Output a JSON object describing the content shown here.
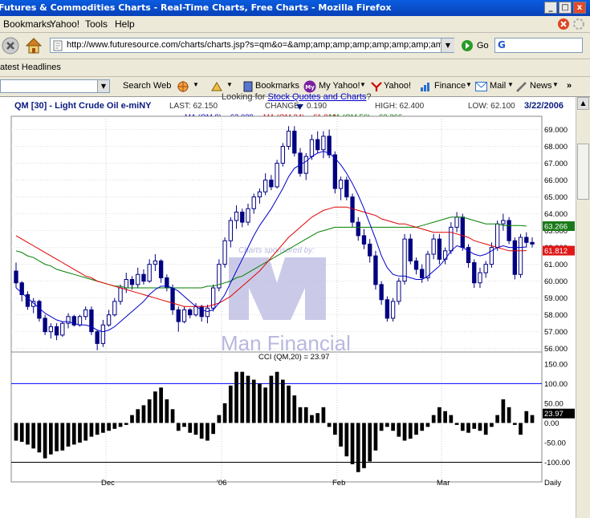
{
  "window": {
    "title": "Futures & Commodities Charts - Real-Time Charts, Free Charts - Mozilla Firefox",
    "min": "_",
    "max": "□",
    "close": "x"
  },
  "menu": [
    "Bookmarks",
    "Yahoo!",
    "Tools",
    "Help"
  ],
  "nav": {
    "url": "http://www.futuresource.com/charts/charts.jsp?s=qm&o=&amp;amp;amp;amp;amp;amp;amp;amp;amp;a=D",
    "go": "Go",
    "search_letter": "G"
  },
  "bookmarks_bar": {
    "item": "atest Headlines"
  },
  "yahoo_toolbar": {
    "search_web": "Search Web",
    "bookmarks": "Bookmarks",
    "my_yahoo": "My Yahoo!",
    "yahoo": "Yahoo!",
    "finance": "Finance",
    "mail": "Mail",
    "news": "News",
    "more": "»",
    "my": "My"
  },
  "page": {
    "link_prefix": "Looking for ",
    "link_text": "Stock Quotes and Charts",
    "link_suffix": "?"
  },
  "chart": {
    "symbol": "QM [30] - Light Crude Oil e-miNY",
    "last": "LAST: 62.150",
    "change_label": "CHANGE:",
    "change_value": "0.190",
    "high": "HIGH: 62.400",
    "low": "LOW: 62.100",
    "date": "3/22/2006",
    "ma9": "MA (QM,9) = 62.029",
    "ma34": "MA (QM,34) = 61.812",
    "ma50": "MA (QM,50) = 63.266",
    "price_ticks": [
      "69.000",
      "68.000",
      "67.000",
      "66.000",
      "65.000",
      "64.000",
      "63.000",
      "62.000",
      "61.000",
      "60.000",
      "59.000",
      "58.000",
      "57.000",
      "56.000"
    ],
    "tag_ma50": "63.266",
    "tag_ma34": "61.812",
    "watermark_sponsor": "Charts sponsored by:",
    "watermark_brand": "Man Financial",
    "cci_label": "CCI (QM,20) = 23.97",
    "cci_ticks": [
      "150.00",
      "100.00",
      "50.00",
      "0.00",
      "-50.00",
      "-100.00"
    ],
    "cci_tag": "23.97",
    "x_labels": [
      "Dec",
      "'06",
      "Feb",
      "Mar"
    ],
    "period": "Daily",
    "colors": {
      "ma9": "#0000cc",
      "ma34": "#e00000",
      "ma50": "#008000",
      "candle": "#000080",
      "candle_up": "#ffffff",
      "levels": "#0000ff",
      "watermark": "#b8b8e0"
    }
  },
  "chart_data": {
    "type": "candlestick",
    "title": "QM [30] - Light Crude Oil e-miNY",
    "price_range": [
      55.7,
      69.5
    ],
    "cci_range": [
      -150,
      160
    ],
    "series": [
      {
        "name": "MA (QM,9)",
        "last": 62.029
      },
      {
        "name": "MA (QM,34)",
        "last": 61.812
      },
      {
        "name": "MA (QM,50)",
        "last": 63.266
      },
      {
        "name": "CCI (QM,20)",
        "last": 23.97
      }
    ],
    "ohlc": [
      [
        60.6,
        61.1,
        59.6,
        59.9
      ],
      [
        59.9,
        60.0,
        58.8,
        59.2
      ],
      [
        59.2,
        59.4,
        58.3,
        58.5
      ],
      [
        58.5,
        59.0,
        58.1,
        58.8
      ],
      [
        58.8,
        58.9,
        57.6,
        57.8
      ],
      [
        57.8,
        58.0,
        56.8,
        57.0
      ],
      [
        57.0,
        57.5,
        56.6,
        57.3
      ],
      [
        57.3,
        57.5,
        56.5,
        56.8
      ],
      [
        56.8,
        57.6,
        56.7,
        57.5
      ],
      [
        57.5,
        58.1,
        57.2,
        57.9
      ],
      [
        57.9,
        58.0,
        57.3,
        57.4
      ],
      [
        57.4,
        58.0,
        57.3,
        57.9
      ],
      [
        57.9,
        58.5,
        57.7,
        58.3
      ],
      [
        58.3,
        58.5,
        56.8,
        57.0
      ],
      [
        57.0,
        57.1,
        55.9,
        56.3
      ],
      [
        56.3,
        57.7,
        56.1,
        57.4
      ],
      [
        57.4,
        58.3,
        57.3,
        58.0
      ],
      [
        58.0,
        59.0,
        57.9,
        58.8
      ],
      [
        58.8,
        59.8,
        58.6,
        59.6
      ],
      [
        59.6,
        60.5,
        59.3,
        60.1
      ],
      [
        60.1,
        60.3,
        59.5,
        59.8
      ],
      [
        59.8,
        60.8,
        59.6,
        60.4
      ],
      [
        60.4,
        60.7,
        59.8,
        60.0
      ],
      [
        60.0,
        61.3,
        59.9,
        61.0
      ],
      [
        61.0,
        61.6,
        60.6,
        61.2
      ],
      [
        61.2,
        61.3,
        59.9,
        60.2
      ],
      [
        60.2,
        60.4,
        59.4,
        59.6
      ],
      [
        59.6,
        59.8,
        58.0,
        58.3
      ],
      [
        58.3,
        58.5,
        57.0,
        57.6
      ],
      [
        57.6,
        58.5,
        57.5,
        58.3
      ],
      [
        58.3,
        58.4,
        57.8,
        58.0
      ],
      [
        58.0,
        58.7,
        57.9,
        58.5
      ],
      [
        58.5,
        58.6,
        57.6,
        57.9
      ],
      [
        57.9,
        58.6,
        57.5,
        58.4
      ],
      [
        58.4,
        59.8,
        58.2,
        59.6
      ],
      [
        59.6,
        61.3,
        59.4,
        61.0
      ],
      [
        61.0,
        62.6,
        60.8,
        62.4
      ],
      [
        62.4,
        63.8,
        62.0,
        63.6
      ],
      [
        63.6,
        64.5,
        63.1,
        64.1
      ],
      [
        64.1,
        64.3,
        63.2,
        63.5
      ],
      [
        63.5,
        64.6,
        63.3,
        64.3
      ],
      [
        64.3,
        65.2,
        64.0,
        65.0
      ],
      [
        65.0,
        65.5,
        64.6,
        65.3
      ],
      [
        65.3,
        66.4,
        65.1,
        66.0
      ],
      [
        66.0,
        66.3,
        65.4,
        65.6
      ],
      [
        65.6,
        67.2,
        65.5,
        67.0
      ],
      [
        67.0,
        68.2,
        66.8,
        68.0
      ],
      [
        68.0,
        69.2,
        67.8,
        68.9
      ],
      [
        68.9,
        69.2,
        67.4,
        67.6
      ],
      [
        67.6,
        67.9,
        66.2,
        66.4
      ],
      [
        66.4,
        67.6,
        66.0,
        67.4
      ],
      [
        67.4,
        68.7,
        67.2,
        68.4
      ],
      [
        68.4,
        68.9,
        67.6,
        67.8
      ],
      [
        67.8,
        68.9,
        67.3,
        68.6
      ],
      [
        68.6,
        69.0,
        67.3,
        67.5
      ],
      [
        67.5,
        67.7,
        65.2,
        65.5
      ],
      [
        65.5,
        66.2,
        64.8,
        66.0
      ],
      [
        66.0,
        66.2,
        64.8,
        65.0
      ],
      [
        65.0,
        65.2,
        63.2,
        63.5
      ],
      [
        63.5,
        63.8,
        62.4,
        62.7
      ],
      [
        62.7,
        63.1,
        61.9,
        62.2
      ],
      [
        62.2,
        62.5,
        61.1,
        61.5
      ],
      [
        61.5,
        61.8,
        59.5,
        59.8
      ],
      [
        59.8,
        60.0,
        58.6,
        58.9
      ],
      [
        58.9,
        59.1,
        57.6,
        57.8
      ],
      [
        57.8,
        59.0,
        57.6,
        58.8
      ],
      [
        58.8,
        60.2,
        58.6,
        60.0
      ],
      [
        60.0,
        62.8,
        59.8,
        62.5
      ],
      [
        62.5,
        62.8,
        61.0,
        61.2
      ],
      [
        61.2,
        61.4,
        60.4,
        60.7
      ],
      [
        60.7,
        61.0,
        59.9,
        60.2
      ],
      [
        60.2,
        61.8,
        60.0,
        61.6
      ],
      [
        61.6,
        62.8,
        61.3,
        62.5
      ],
      [
        62.5,
        62.8,
        61.0,
        61.3
      ],
      [
        61.3,
        62.0,
        61.0,
        61.8
      ],
      [
        61.8,
        63.5,
        61.6,
        63.2
      ],
      [
        63.2,
        64.1,
        62.9,
        63.8
      ],
      [
        63.8,
        64.0,
        61.8,
        62.0
      ],
      [
        62.0,
        62.2,
        60.8,
        61.1
      ],
      [
        61.1,
        61.3,
        59.6,
        59.9
      ],
      [
        59.9,
        60.8,
        59.6,
        60.5
      ],
      [
        60.5,
        61.2,
        60.2,
        61.0
      ],
      [
        61.0,
        62.3,
        60.8,
        62.0
      ],
      [
        62.0,
        63.6,
        61.8,
        63.4
      ],
      [
        63.4,
        64.0,
        63.0,
        63.6
      ],
      [
        63.6,
        63.8,
        62.2,
        62.4
      ],
      [
        62.4,
        62.6,
        60.1,
        60.4
      ],
      [
        60.4,
        62.8,
        60.2,
        62.6
      ],
      [
        62.6,
        62.9,
        62.0,
        62.3
      ],
      [
        62.3,
        62.6,
        62.0,
        62.2
      ]
    ],
    "cci": [
      -45,
      -48,
      -55,
      -65,
      -75,
      -90,
      -80,
      -72,
      -70,
      -60,
      -55,
      -50,
      -45,
      -35,
      -30,
      -25,
      -20,
      -15,
      -10,
      -5,
      20,
      35,
      45,
      60,
      80,
      90,
      60,
      35,
      -20,
      -10,
      -25,
      -30,
      -40,
      -45,
      -28,
      20,
      50,
      95,
      130,
      130,
      120,
      110,
      100,
      90,
      120,
      130,
      110,
      95,
      70,
      40,
      40,
      20,
      25,
      40,
      -10,
      -30,
      -60,
      -85,
      -105,
      -125,
      -115,
      -98,
      -70,
      -20,
      -10,
      -20,
      -35,
      -45,
      -40,
      -30,
      -20,
      -10,
      20,
      40,
      30,
      20,
      -5,
      -20,
      -25,
      -15,
      -20,
      -30,
      -10,
      20,
      60,
      40,
      -5,
      -30,
      30,
      20
    ],
    "ma9": [
      59.6,
      59.3,
      59.0,
      58.7,
      58.4,
      58.1,
      57.9,
      57.7,
      57.6,
      57.6,
      57.5,
      57.4,
      57.4,
      57.3,
      57.1,
      57.0,
      57.1,
      57.3,
      57.6,
      57.9,
      58.2,
      58.5,
      58.8,
      59.2,
      59.5,
      59.7,
      59.7,
      59.6,
      59.4,
      59.1,
      58.8,
      58.5,
      58.3,
      58.2,
      58.3,
      58.7,
      59.2,
      59.9,
      60.6,
      61.3,
      62.0,
      62.7,
      63.3,
      63.8,
      64.3,
      64.9,
      65.5,
      66.2,
      66.7,
      66.9,
      67.1,
      67.4,
      67.6,
      67.7,
      67.6,
      67.3,
      66.9,
      66.4,
      65.8,
      65.1,
      64.3,
      63.4,
      62.5,
      61.5,
      60.8,
      60.4,
      60.3,
      60.3,
      60.2,
      60.1,
      60.1,
      60.3,
      60.6,
      60.9,
      61.3,
      61.8,
      62.1,
      62.0,
      61.8,
      61.6,
      61.5,
      61.6,
      61.8,
      62.0,
      62.1,
      62.0,
      62.0,
      62.0,
      62.03
    ],
    "ma34": [
      62.7,
      62.5,
      62.3,
      62.1,
      61.9,
      61.7,
      61.5,
      61.3,
      61.1,
      60.9,
      60.7,
      60.5,
      60.3,
      60.2,
      60.0,
      59.9,
      59.8,
      59.7,
      59.6,
      59.5,
      59.4,
      59.3,
      59.2,
      59.1,
      59.0,
      58.9,
      58.8,
      58.7,
      58.6,
      58.5,
      58.5,
      58.5,
      58.5,
      58.5,
      58.6,
      58.7,
      58.9,
      59.1,
      59.4,
      59.7,
      60.0,
      60.3,
      60.6,
      61.0,
      61.4,
      61.8,
      62.2,
      62.6,
      62.9,
      63.2,
      63.5,
      63.8,
      64.0,
      64.2,
      64.3,
      64.4,
      64.4,
      64.4,
      64.3,
      64.2,
      64.1,
      64.0,
      63.9,
      63.7,
      63.6,
      63.5,
      63.4,
      63.4,
      63.3,
      63.2,
      63.1,
      63.0,
      62.9,
      62.9,
      62.9,
      62.9,
      62.8,
      62.7,
      62.6,
      62.4,
      62.3,
      62.2,
      62.1,
      62.0,
      61.9,
      61.8,
      61.8,
      61.8,
      61.81
    ],
    "ma50": [
      61.8,
      61.7,
      61.5,
      61.4,
      61.2,
      61.0,
      60.9,
      60.7,
      60.6,
      60.5,
      60.4,
      60.3,
      60.2,
      60.1,
      60.0,
      59.9,
      59.8,
      59.7,
      59.7,
      59.6,
      59.6,
      59.6,
      59.6,
      59.6,
      59.6,
      59.6,
      59.6,
      59.6,
      59.6,
      59.6,
      59.6,
      59.6,
      59.6,
      59.7,
      59.7,
      59.8,
      59.9,
      60.0,
      60.2,
      60.3,
      60.5,
      60.7,
      60.9,
      61.1,
      61.3,
      61.5,
      61.7,
      61.9,
      62.1,
      62.3,
      62.5,
      62.7,
      62.9,
      63.0,
      63.1,
      63.2,
      63.2,
      63.2,
      63.2,
      63.2,
      63.2,
      63.2,
      63.2,
      63.2,
      63.2,
      63.2,
      63.2,
      63.2,
      63.2,
      63.2,
      63.3,
      63.4,
      63.5,
      63.6,
      63.7,
      63.8,
      63.8,
      63.8,
      63.7,
      63.6,
      63.5,
      63.4,
      63.4,
      63.4,
      63.3,
      63.3,
      63.3,
      63.3,
      63.266
    ]
  }
}
